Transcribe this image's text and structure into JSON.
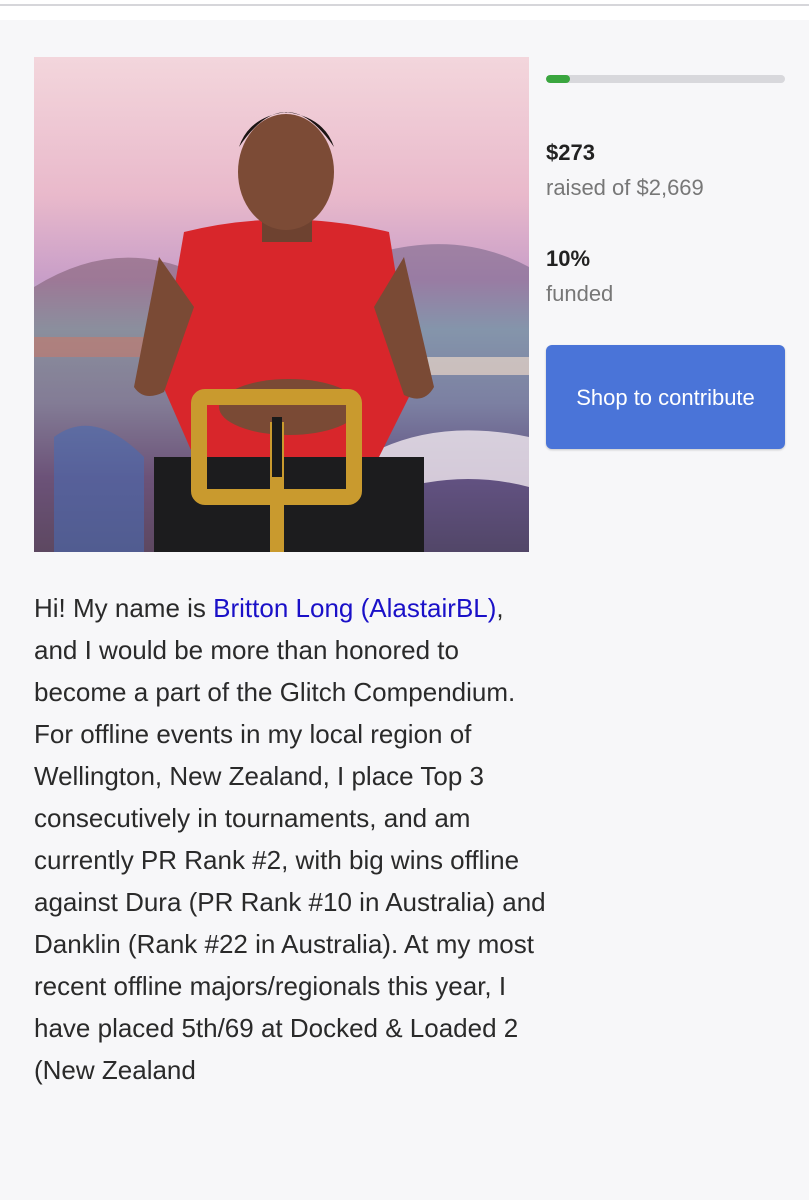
{
  "campaign": {
    "progress": {
      "fraction": 0.1,
      "color": "#3aa63f"
    },
    "raised_amount": "$273",
    "raised_label": "raised of $2,669",
    "funded_percent": "10%",
    "funded_label": "funded",
    "cta_label": "Shop to contribute",
    "cta_color": "#4a74d8"
  },
  "story": {
    "intro": "Hi! My name is ",
    "link_text": "Britton Long (AlastairBL)",
    "link_color": "#1a10c8",
    "body": ", and I would be more than honored to become a part of the Glitch Compendium. For offline events in my local region of Wellington, New Zealand, I place Top 3 consecutively in tournaments, and am currently PR Rank #2, with big wins offline against Dura (PR Rank #10 in Australia) and Danklin (Rank #22 in Australia). At my most recent offline majors/regionals this year, I have placed 5th/69 at Docked & Loaded 2 (New Zealand"
  }
}
